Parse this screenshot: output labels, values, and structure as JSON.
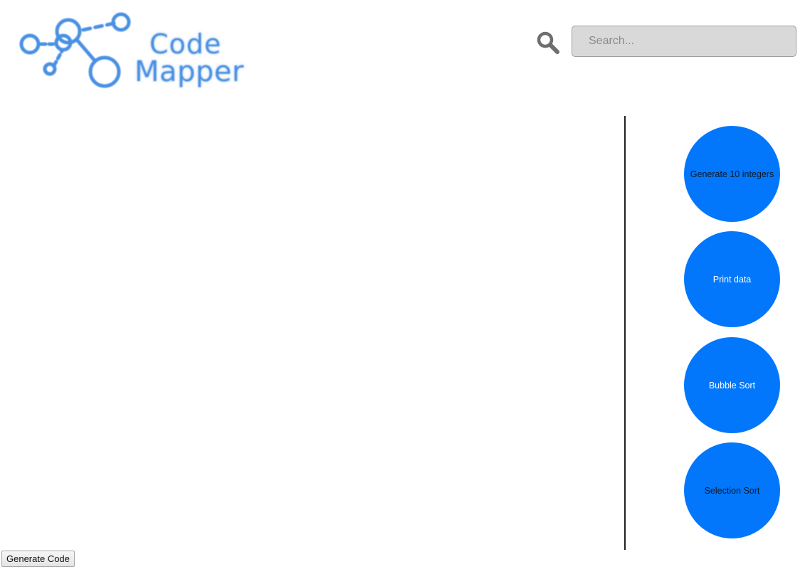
{
  "header": {
    "logo": {
      "line1": "Code",
      "line2": "Mapper"
    },
    "search": {
      "placeholder": "Search..."
    }
  },
  "palette": {
    "items": [
      {
        "label": "Generate 10 integers"
      },
      {
        "label": "Print data"
      },
      {
        "label": "Bubble Sort"
      },
      {
        "label": "Selection Sort"
      }
    ]
  },
  "footer": {
    "generate_label": "Generate Code"
  },
  "colors": {
    "accent": "#0277fb",
    "logo": "#4a90e2",
    "search_bg": "#d9d9d9"
  },
  "icons": {
    "search": "search-icon",
    "logo": "node-graph-icon"
  }
}
